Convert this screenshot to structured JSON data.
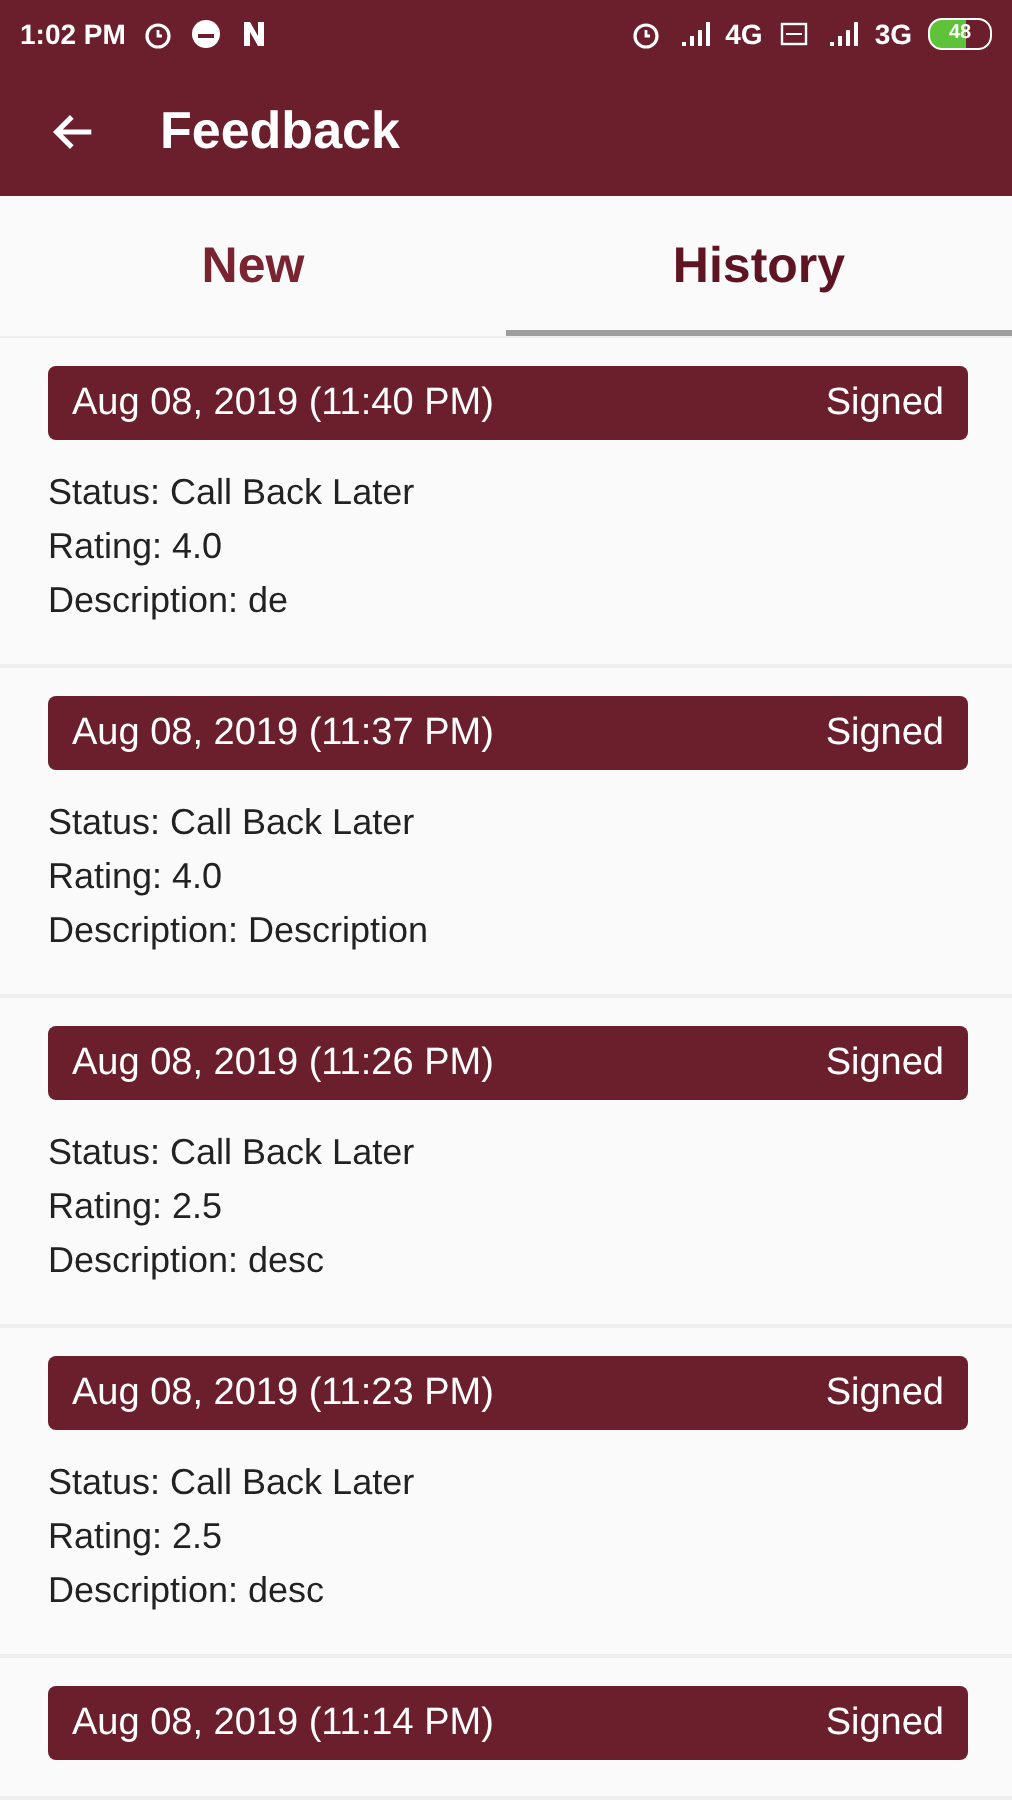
{
  "status_bar": {
    "time": "1:02 PM",
    "network_1": "4G",
    "network_2": "3G",
    "battery": "48"
  },
  "app_bar": {
    "title": "Feedback"
  },
  "tabs": [
    {
      "label": "New",
      "selected": false
    },
    {
      "label": "History",
      "selected": true
    }
  ],
  "entries": [
    {
      "date": "Aug 08, 2019 (11:40 PM)",
      "state": "Signed",
      "status": "Status: Call Back Later",
      "rating": "Rating: 4.0",
      "description": "Description: de"
    },
    {
      "date": "Aug 08, 2019 (11:37 PM)",
      "state": "Signed",
      "status": "Status: Call Back Later",
      "rating": "Rating: 4.0",
      "description": "Description: Description"
    },
    {
      "date": "Aug 08, 2019 (11:26 PM)",
      "state": "Signed",
      "status": "Status: Call Back Later",
      "rating": "Rating: 2.5",
      "description": "Description: desc"
    },
    {
      "date": "Aug 08, 2019 (11:23 PM)",
      "state": "Signed",
      "status": "Status: Call Back Later",
      "rating": "Rating: 2.5",
      "description": "Description: desc"
    },
    {
      "date": "Aug 08, 2019 (11:14 PM)",
      "state": "Signed"
    }
  ]
}
